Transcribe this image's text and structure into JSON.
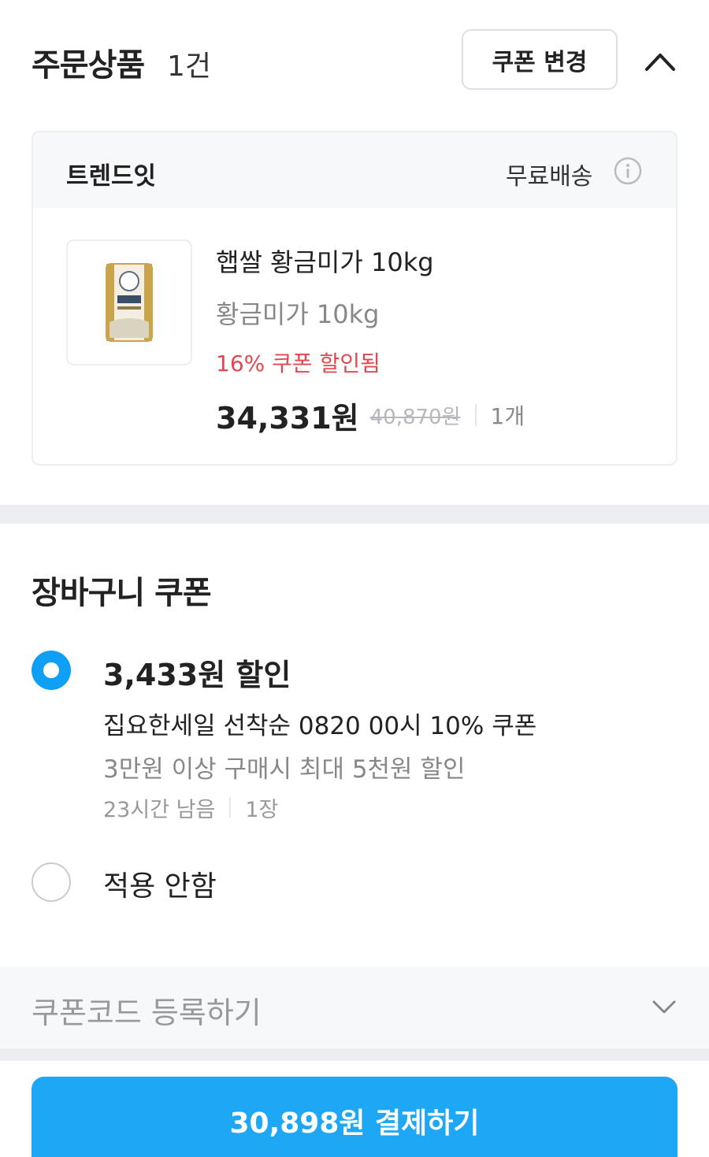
{
  "header": {
    "title": "주문상품",
    "count": "1건",
    "coupon_change_label": "쿠폰 변경",
    "collapse_icon": "chevron-up-icon"
  },
  "store": {
    "name": "트렌드잇",
    "shipping": "무료배송",
    "info_icon": "info-icon"
  },
  "product": {
    "name": "햅쌀 황금미가 10kg",
    "option": "황금미가 10kg",
    "discount_text": "16% 쿠폰 할인됨",
    "sale_price": "34,331원",
    "original_price": "40,870원",
    "quantity": "1개"
  },
  "cart_coupon": {
    "title": "장바구니 쿠폰",
    "options": [
      {
        "selected": true,
        "amount": "3,433원 할인",
        "name": "집요한세일 선착순 0820 00시 10% 쿠폰",
        "condition": "3만원 이상 구매시 최대 5천원 할인",
        "remaining": "23시간 남음",
        "count": "1장"
      },
      {
        "selected": false,
        "label": "적용 안함"
      }
    ]
  },
  "coupon_code": {
    "label": "쿠폰코드 등록하기",
    "expand_icon": "chevron-down-icon"
  },
  "pay_button": {
    "label": "30,898원 결제하기"
  },
  "colors": {
    "accent": "#1ea7f5",
    "discount_red": "#e0484e",
    "muted_text": "#888888"
  }
}
